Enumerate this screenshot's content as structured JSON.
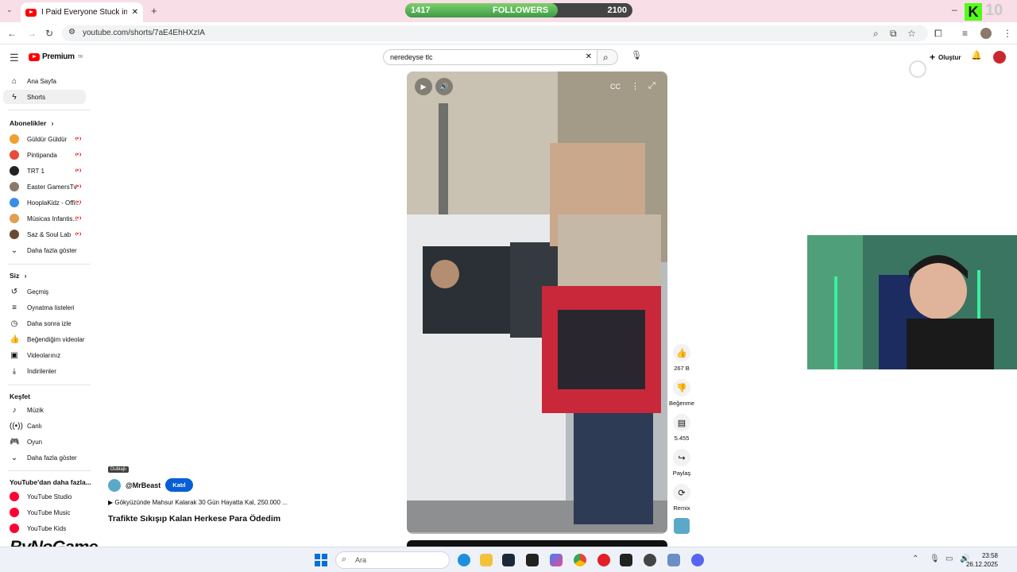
{
  "browser": {
    "tab_title": "I Paid Everyone Stuck in Traffic",
    "url": "youtube.com/shorts/7aE4EhHXzIA"
  },
  "overlay": {
    "followers_label": "FOLLOWERS",
    "followers_current": "1417",
    "followers_goal": "2100",
    "followers_progress": 0.67,
    "corner_logo": "K",
    "corner_number": "10",
    "watermark": "ByNoGame"
  },
  "youtube": {
    "logo_text": "Premium",
    "logo_region": "TR",
    "search_value": "neredeyse  tlc",
    "create_label": "Oluştur"
  },
  "sidebar": {
    "main": [
      {
        "label": "Ana Sayfa",
        "icon": "home-icon"
      },
      {
        "label": "Shorts",
        "icon": "shorts-icon"
      }
    ],
    "subscriptions_title": "Abonelikler",
    "subscriptions": [
      {
        "label": "Güldür Güldür",
        "color": "#f0a030"
      },
      {
        "label": "Pintipanda",
        "color": "#e84a3c"
      },
      {
        "label": "TRT 1",
        "color": "#222222"
      },
      {
        "label": "Easter GamersTv",
        "color": "#8a7a6a"
      },
      {
        "label": "HooplaKidz - Offi...",
        "color": "#3a8ee6"
      },
      {
        "label": "Músicas Infantis...",
        "color": "#e0a050"
      },
      {
        "label": "Saz & Soul Lab",
        "color": "#6a4a30"
      }
    ],
    "show_more": "Daha fazla göster",
    "you_title": "Siz",
    "you_items": [
      {
        "label": "Geçmiş",
        "icon": "history-icon"
      },
      {
        "label": "Oynatma listeleri",
        "icon": "playlists-icon"
      },
      {
        "label": "Daha sonra izle",
        "icon": "watch-later-icon"
      },
      {
        "label": "Beğendiğim videolar",
        "icon": "liked-icon"
      },
      {
        "label": "Videolarınız",
        "icon": "your-videos-icon"
      },
      {
        "label": "İndirilenler",
        "icon": "downloads-icon"
      }
    ],
    "explore_title": "Keşfet",
    "explore_items": [
      {
        "label": "Müzik",
        "icon": "music-icon"
      },
      {
        "label": "Canlı",
        "icon": "live-icon"
      },
      {
        "label": "Oyun",
        "icon": "gaming-icon"
      }
    ],
    "explore_more": "Daha fazla göster",
    "more_title": "YouTube'dan daha fazla...",
    "more_items": [
      {
        "label": "YouTube Studio"
      },
      {
        "label": "YouTube Music"
      },
      {
        "label": "YouTube Kids"
      }
    ]
  },
  "short": {
    "dubbed_badge": "Dublajlı",
    "channel": "@MrBeast",
    "join_label": "Katıl",
    "description": "▶ Gökyüzünde Mahsur Kalarak 30 Gün Hayatta Kal, 250.000 ...",
    "title": "Trafikte Sıkışıp Kalan Herkese Para Ödedim",
    "likes": "267 B",
    "dislike_label": "Beğenme",
    "comments": "5.455",
    "share_label": "Paylaş",
    "remix_label": "Remix",
    "progress": 0.01
  },
  "taskbar": {
    "search_placeholder": "Ara",
    "time": "23:58",
    "date": "26.12.2025"
  }
}
